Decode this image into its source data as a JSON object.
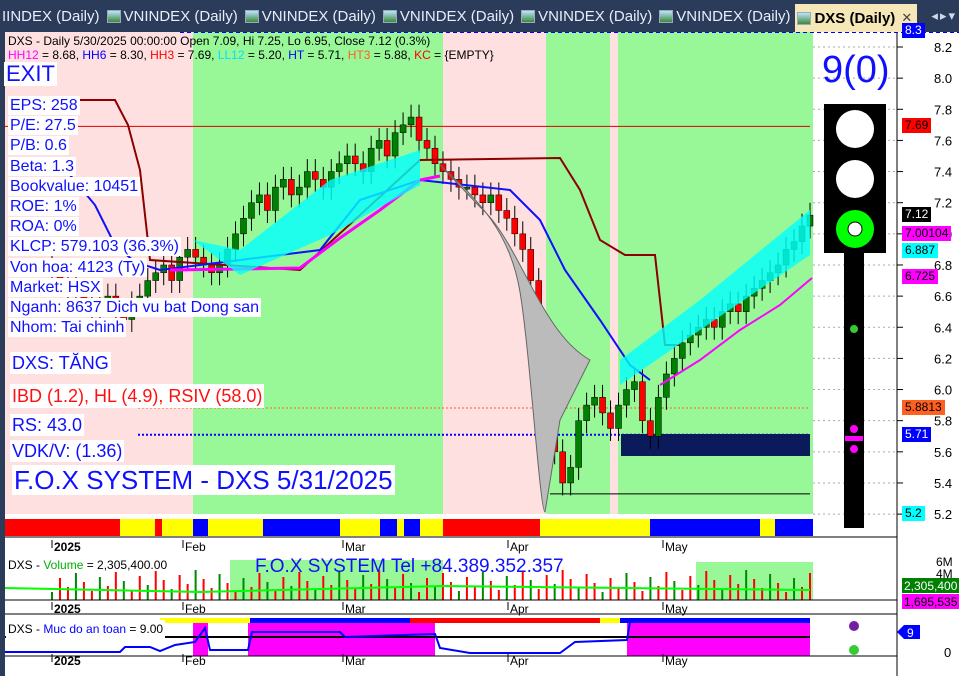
{
  "tabs": [
    {
      "label": "IINDEX (Daily)"
    },
    {
      "label": "VNINDEX (Daily)"
    },
    {
      "label": "VNINDEX (Daily)"
    },
    {
      "label": "VNINDEX (Daily)"
    },
    {
      "label": "VNINDEX (Daily)"
    },
    {
      "label": "VNINDEX (Daily)"
    },
    {
      "label": "DXS (Daily)",
      "active": true
    }
  ],
  "header": {
    "line1": "DXS - Daily 5/30/2025 00:00:00 Open 7.09, Hi 7.25, Lo 6.95, Close 7.12 (0.3%)",
    "line2": [
      {
        "t": "HH12",
        "c": "#ff00ff"
      },
      {
        "t": " = 8.68, ",
        "c": "#000"
      },
      {
        "t": "HH6",
        "c": "#0000ff"
      },
      {
        "t": " = 8.30, ",
        "c": "#000"
      },
      {
        "t": "HH3",
        "c": "#ff0000"
      },
      {
        "t": " = 7.69, ",
        "c": "#000"
      },
      {
        "t": "LL12",
        "c": "#00e0ff"
      },
      {
        "t": " = 5.20, ",
        "c": "#000"
      },
      {
        "t": "HT",
        "c": "#0000ff"
      },
      {
        "t": "  = 5.71, ",
        "c": "#000"
      },
      {
        "t": "HT3",
        "c": "#ff6020"
      },
      {
        "t": "  = 5.88, ",
        "c": "#000"
      },
      {
        "t": "KC",
        "c": "#ff0000"
      },
      {
        "t": " = {EMPTY}",
        "c": "#000"
      }
    ]
  },
  "info": {
    "signal": "EXIT",
    "eps": "EPS: 258",
    "pe": "P/E: 27.5",
    "pb": "P/B: 0.6",
    "beta": "Beta: 1.3",
    "bookvalue": "Bookvalue: 10451",
    "roe": "ROE: 1%",
    "roa": "ROA: 0%",
    "klcp": "KLCP: 579.103 (36.3%)",
    "vonhoa": "Von hoa: 4123 (Ty)",
    "market": "Market: HSX",
    "nganh": "Nganh: 8637 Dich vu bat Dong san",
    "nhom": "Nhom: Tai chinh",
    "trend": "DXS: TĂNG",
    "ibd": "IBD (1.2), HL (4.9), RSIV (58.0)",
    "rs": "RS: 43.0",
    "vdk": "VDK/V:  (1.36)",
    "banner": "F.O.X SYSTEM - DXS 5/31/2025",
    "score": "9(0)"
  },
  "volume": {
    "title_prefix": "DXS - ",
    "title_name": "Volume",
    "title_value": " = 2,305,400.00",
    "banner": "F.O.X SYSTEM Tel +84.389.352.357",
    "labels": [
      {
        "text": "2,305,400",
        "color": "#008000"
      },
      {
        "text": "1,695,535",
        "color": "#ff00ff"
      }
    ],
    "ticks": [
      "6M",
      "4M"
    ]
  },
  "safety": {
    "title_prefix": "DXS - ",
    "title_name": "Muc do an toan",
    "title_value": " = 9.00",
    "label": "9",
    "tick": "0"
  },
  "months": [
    "2025",
    "Feb",
    "Mar",
    "Apr",
    "May"
  ],
  "colors": {
    "up": "#008000",
    "down": "#ff0000",
    "bg_up": "#98f898",
    "bg_down": "#ffe0e0",
    "accent": "#0000ff"
  },
  "chart_data": {
    "type": "candlestick",
    "title": "DXS - Daily",
    "ylim": [
      5.1,
      8.3
    ],
    "yticks": [
      "8.2",
      "8.0",
      "7.8",
      "7.6",
      "7.4",
      "7.2",
      "7.0",
      "6.8",
      "6.6",
      "6.4",
      "6.2",
      "6.0",
      "5.8",
      "5.6",
      "5.4",
      "5.2"
    ],
    "x_range": [
      "2025-01-02",
      "2025-05-30"
    ],
    "closes": [
      6.75,
      6.7,
      6.65,
      6.6,
      6.55,
      6.5,
      6.55,
      6.6,
      6.5,
      6.45,
      6.55,
      6.6,
      6.7,
      6.75,
      6.8,
      6.7,
      6.85,
      6.9,
      6.85,
      6.8,
      6.75,
      6.8,
      6.9,
      7.0,
      7.1,
      7.2,
      7.25,
      7.15,
      7.3,
      7.35,
      7.25,
      7.3,
      7.4,
      7.35,
      7.3,
      7.4,
      7.45,
      7.5,
      7.45,
      7.4,
      7.55,
      7.6,
      7.5,
      7.65,
      7.7,
      7.75,
      7.6,
      7.55,
      7.45,
      7.4,
      7.35,
      7.3,
      7.3,
      7.25,
      7.2,
      7.25,
      7.15,
      7.1,
      7.0,
      6.9,
      6.7,
      6.3,
      5.9,
      5.6,
      5.4,
      5.5,
      5.8,
      5.9,
      5.95,
      5.85,
      5.75,
      5.9,
      6.0,
      6.05,
      5.8,
      5.7,
      5.95,
      6.1,
      6.2,
      6.3,
      6.35,
      6.4,
      6.45,
      6.4,
      6.5,
      6.55,
      6.5,
      6.6,
      6.65,
      6.7,
      6.75,
      6.8,
      6.9,
      6.95,
      7.05,
      7.12
    ],
    "levels": [
      {
        "name": "HH3",
        "value": 7.69,
        "label": "7.69",
        "color": "#ff0000"
      },
      {
        "name": "HT3",
        "value": 5.8813,
        "label": "5.8813",
        "color": "#ff6020"
      },
      {
        "name": "HT",
        "value": 5.71,
        "label": "5.71",
        "color": "#0000ff"
      }
    ],
    "axis_labels": [
      {
        "value": 8.3,
        "label": "8.3",
        "bg": "#0000ff",
        "fg": "#fff"
      },
      {
        "value": 7.69,
        "label": "7.69",
        "bg": "#ff0000",
        "fg": "#000"
      },
      {
        "value": 7.12,
        "label": "7.12",
        "bg": "#000",
        "fg": "#fff"
      },
      {
        "value": 7.00104,
        "label": "7.00104",
        "bg": "#ff00ff",
        "fg": "#000"
      },
      {
        "value": 6.887,
        "label": "6.887",
        "bg": "#00ffff",
        "fg": "#000"
      },
      {
        "value": 6.725,
        "label": "6.725",
        "bg": "#ff00ff",
        "fg": "#000"
      },
      {
        "value": 5.8813,
        "label": "5.8813",
        "bg": "#ff6020",
        "fg": "#000"
      },
      {
        "value": 5.71,
        "label": "5.71",
        "bg": "#0000ff",
        "fg": "#fff"
      },
      {
        "value": 5.2,
        "label": "5.2",
        "bg": "#00ffff",
        "fg": "#000"
      }
    ],
    "traffic_light": "green"
  }
}
